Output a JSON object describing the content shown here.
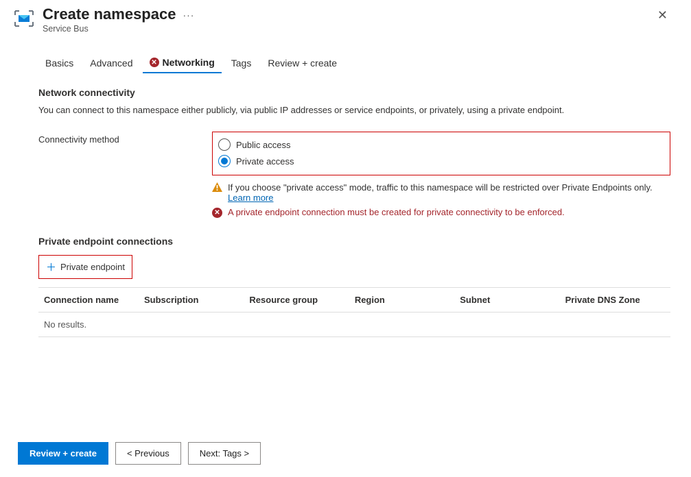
{
  "header": {
    "title": "Create namespace",
    "subtitle": "Service Bus"
  },
  "tabs": {
    "basics": "Basics",
    "advanced": "Advanced",
    "networking": "Networking",
    "tags": "Tags",
    "review": "Review + create"
  },
  "networking": {
    "section_title": "Network connectivity",
    "section_desc": "You can connect to this namespace either publicly, via public IP addresses or service endpoints, or privately, using a private endpoint.",
    "connectivity_label": "Connectivity method",
    "radios": {
      "public": "Public access",
      "private": "Private access"
    },
    "warn_text": "If you choose \"private access\" mode, traffic to this namespace will be restricted over Private Endpoints only.",
    "learn_more": "Learn more",
    "err_text": "A private endpoint connection must be created for private connectivity to be enforced.",
    "section2_title": "Private endpoint connections",
    "add_btn": "Private endpoint",
    "columns": {
      "name": "Connection name",
      "sub": "Subscription",
      "rg": "Resource group",
      "region": "Region",
      "subnet": "Subnet",
      "dns": "Private DNS Zone"
    },
    "no_results": "No results."
  },
  "footer": {
    "review": "Review + create",
    "prev": "< Previous",
    "next": "Next: Tags >"
  }
}
